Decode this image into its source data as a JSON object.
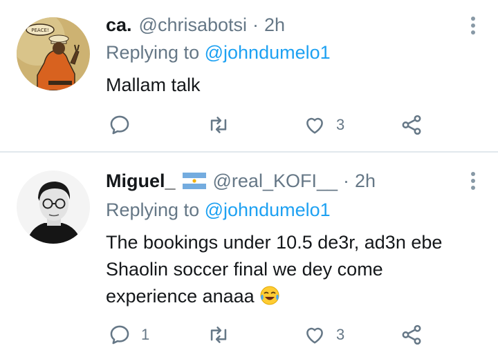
{
  "tweets": [
    {
      "name": "ca.",
      "handle": "@chrisabotsi",
      "separator": "·",
      "time": "2h",
      "replying_prefix": "Replying to",
      "replying_to": "@johndumelo1",
      "text": "Mallam talk",
      "avatar_caption": "PEACE!",
      "replies": "",
      "likes": "3"
    },
    {
      "name": "Miguel_",
      "flag": "argentina-flag-icon",
      "handle": "@real_KOFI__",
      "separator": "·",
      "time": "2h",
      "replying_prefix": "Replying to",
      "replying_to": "@johndumelo1",
      "text_lines": [
        "The bookings under 10.5 de3r, ad3n ebe",
        "Shaolin soccer final we dey come",
        "experience anaaa"
      ],
      "emoji": "face-with-tears-of-joy",
      "replies": "1",
      "likes": "3"
    }
  ],
  "colors": {
    "accent": "#1da1f2",
    "secondary_text": "#657786",
    "icon": "#657786",
    "divider": "#e1e8ed"
  },
  "icons": [
    "reply-icon",
    "retweet-icon",
    "like-icon",
    "share-icon",
    "more-options-icon"
  ]
}
